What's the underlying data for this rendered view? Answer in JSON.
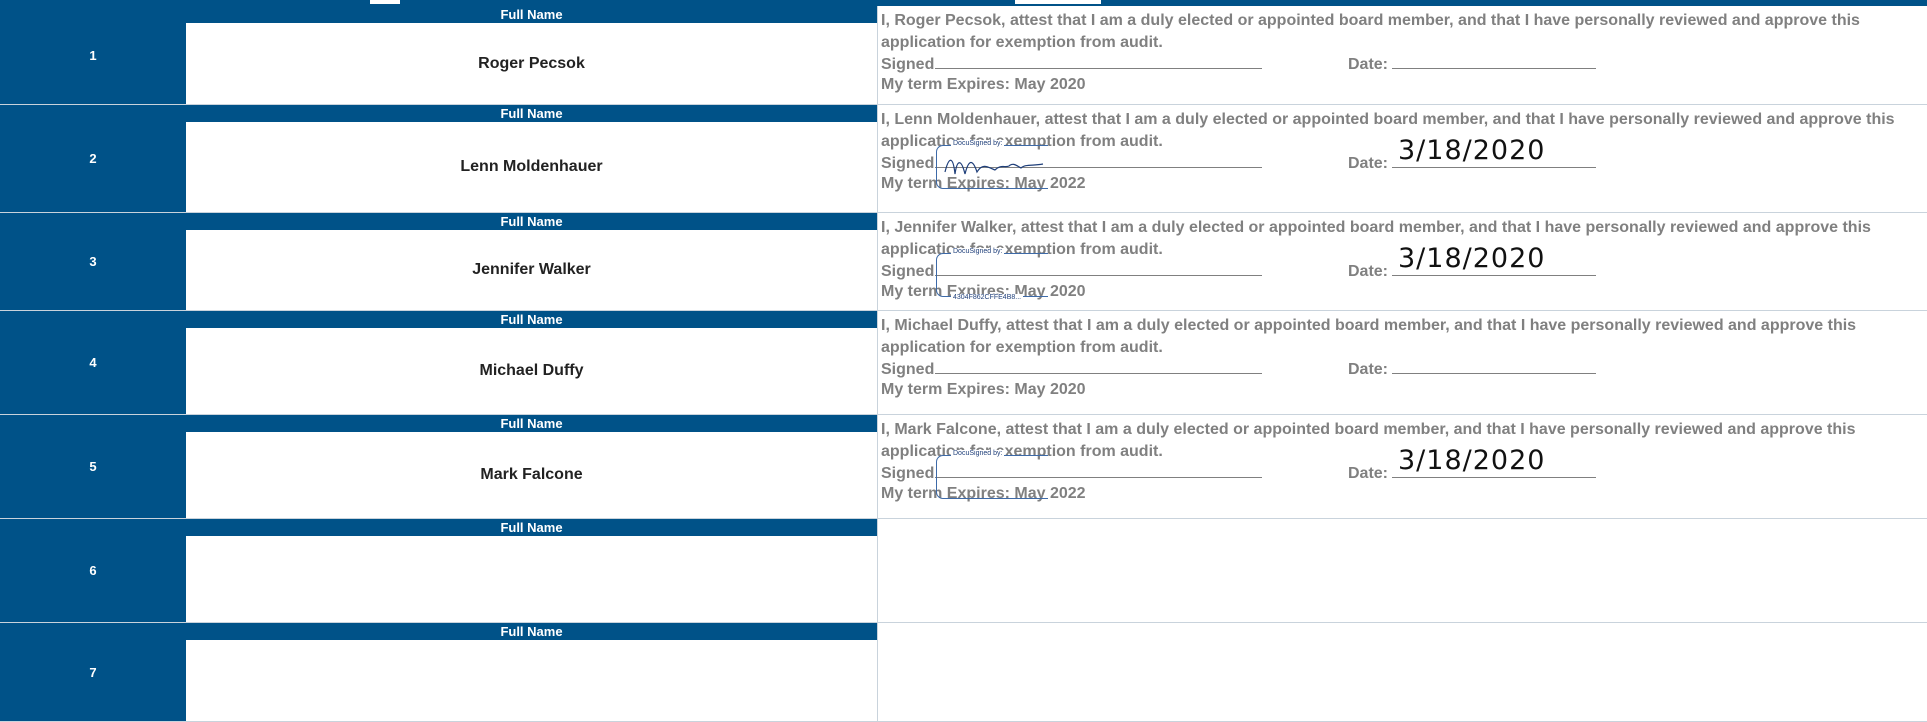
{
  "column_header": "Full Name",
  "labels": {
    "signed": "Signed",
    "date": "Date:"
  },
  "docusign": {
    "header": "DocuSigned by:"
  },
  "members": [
    {
      "number": "1",
      "name": "Roger Pecsok",
      "attestation": "I, Roger Pecsok, attest that I am a duly elected or appointed board member, and that I have personally reviewed and approve this application for exemption from audit.",
      "term": "My term Expires: May 2020",
      "signed_date": "",
      "signature": null
    },
    {
      "number": "2",
      "name": "Lenn Moldenhauer",
      "attestation": "I, Lenn Moldenhauer, attest that I am a duly elected or appointed board member, and that I have personally reviewed and approve this application for exemption from audit.",
      "term": "My term Expires: May 2022",
      "signed_date": "3/18/2020",
      "signature": {
        "script": "Lenn Moldenhauer",
        "envelope_id": ""
      }
    },
    {
      "number": "3",
      "name": "Jennifer Walker",
      "attestation": "I, Jennifer Walker, attest that I am a duly elected or appointed board member, and that I have personally reviewed and approve this application for exemption from audit.",
      "term": "My term Expires: May 2020",
      "signed_date": "3/18/2020",
      "signature": {
        "script": "Jennifer Walker",
        "envelope_id": "4304F862CFFE4B8..."
      }
    },
    {
      "number": "4",
      "name": "Michael Duffy",
      "attestation": "I, Michael Duffy, attest that I am a duly elected or appointed board member, and that I have personally reviewed and approve this application for exemption from audit.",
      "term": "My term Expires: May 2020",
      "signed_date": "",
      "signature": null
    },
    {
      "number": "5",
      "name": "Mark Falcone",
      "attestation": "I, Mark Falcone, attest that I am a duly elected or appointed board member, and that I have personally reviewed and approve this application for exemption from audit.",
      "term": "My term Expires: May 2022",
      "signed_date": "3/18/2020",
      "signature": {
        "script": "MF",
        "envelope_id": ""
      }
    },
    {
      "number": "6",
      "name": "",
      "attestation": "",
      "term": "",
      "signed_date": "",
      "signature": null
    },
    {
      "number": "7",
      "name": "",
      "attestation": "",
      "term": "",
      "signed_date": "",
      "signature": null
    }
  ],
  "colors": {
    "header_blue": "#005288",
    "text_gray": "#808080",
    "docusign_blue": "#3d6aa8"
  }
}
